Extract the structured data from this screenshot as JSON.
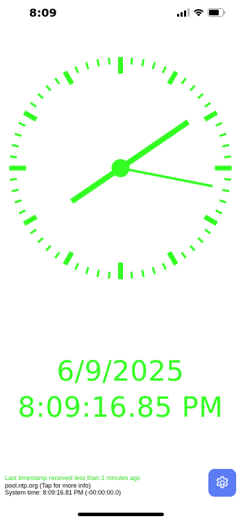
{
  "status_bar": {
    "time": "8:09",
    "icons": [
      "cellular-signal-icon",
      "wifi-icon",
      "battery-icon"
    ]
  },
  "clock": {
    "hours": 8,
    "minutes": 9,
    "seconds": 16.85,
    "color": "#33ff22"
  },
  "display": {
    "date": "6/9/2025",
    "time": "8:09:16.85 PM"
  },
  "footer": {
    "last_timestamp": "Last timestamp received less than 2 minutes ago",
    "server": "pool.ntp.org (Tap for more info)",
    "system_time": "System time: 8:09:16.81 PM (-00:00:00.0)"
  },
  "settings": {
    "icon": "gear-icon",
    "color": "#5b7cf2"
  }
}
